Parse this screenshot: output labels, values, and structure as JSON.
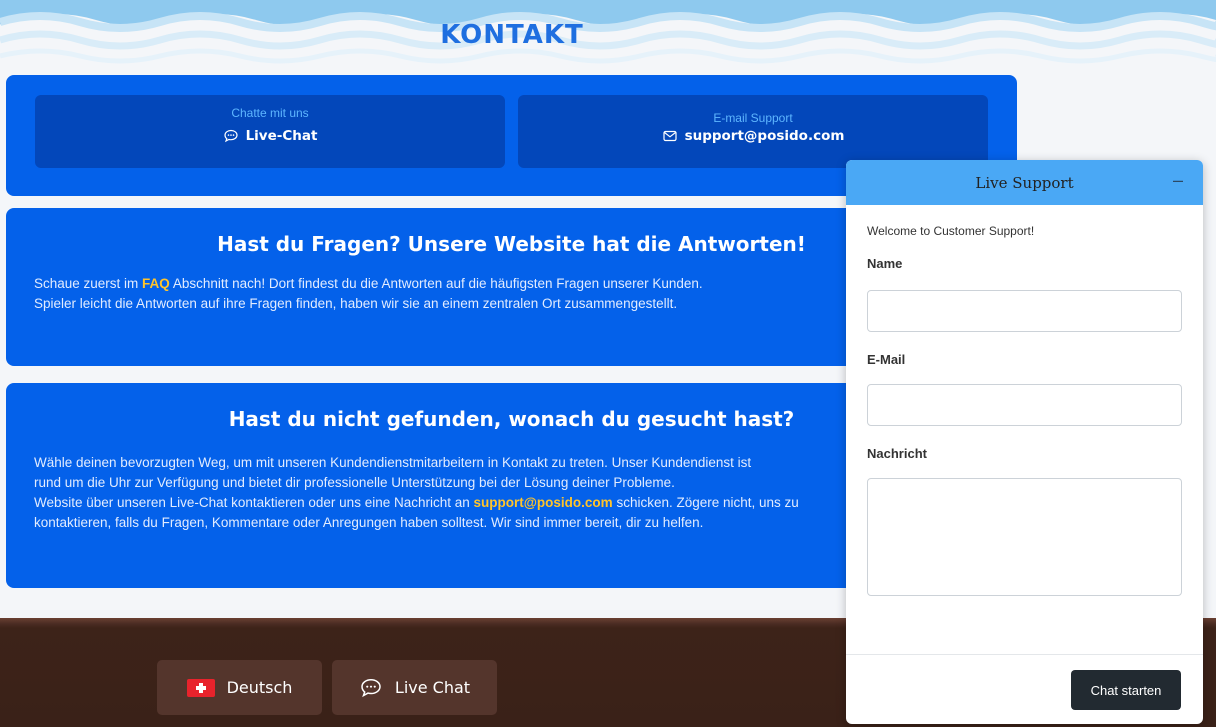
{
  "header": {
    "title": "KONTAKT"
  },
  "contact": {
    "chat": {
      "title": "Chatte mit uns",
      "value": "Live-Chat",
      "icon": "chat-icon"
    },
    "email": {
      "title": "E-mail Support",
      "value": "support@posido.com",
      "icon": "mail-icon"
    }
  },
  "faq": {
    "heading": "Hast du Fragen? Unsere Website hat die Antworten!",
    "line1_a": "Schaue zuerst im ",
    "line1_link": "FAQ",
    "line1_b": " Abschnitt nach! Dort findest du die Antworten auf die häufigsten Fragen unserer Kunden.",
    "line2": "Spieler leicht die Antworten auf ihre Fragen finden, haben wir sie an einem zentralen Ort zusammengestellt."
  },
  "notfound": {
    "heading": "Hast du nicht gefunden, wonach du gesucht hast?",
    "line1": "Wähle deinen bevorzugten Weg, um mit unseren Kundendienstmitarbeitern in Kontakt zu treten. Unser Kundendienst ist",
    "line2": "rund um die Uhr zur Verfügung und bietet dir professionelle Unterstützung bei der Lösung deiner Probleme.",
    "line3_a": "Website über unseren Live-Chat kontaktieren oder uns eine Nachricht an ",
    "line3_email": "support@posido.com",
    "line3_b": " schicken. Zögere nicht, uns zu",
    "line4": "kontaktieren, falls du Fragen, Kommentare oder Anregungen haben solltest. Wir sind immer bereit, dir zu helfen."
  },
  "footer": {
    "language": "Deutsch",
    "livechat": "Live Chat"
  },
  "widget": {
    "title": "Live Support",
    "minimize": "–",
    "welcome": "Welcome to Customer Support!",
    "name_label": "Name",
    "email_label": "E-Mail",
    "message_label": "Nachricht",
    "name_value": "",
    "email_value": "",
    "message_value": "",
    "start_button": "Chat starten"
  },
  "colors": {
    "accent": "#0461ea",
    "highlight": "#ffc42b",
    "widget_header": "#4aa8f5",
    "footer": "#3a2118"
  }
}
